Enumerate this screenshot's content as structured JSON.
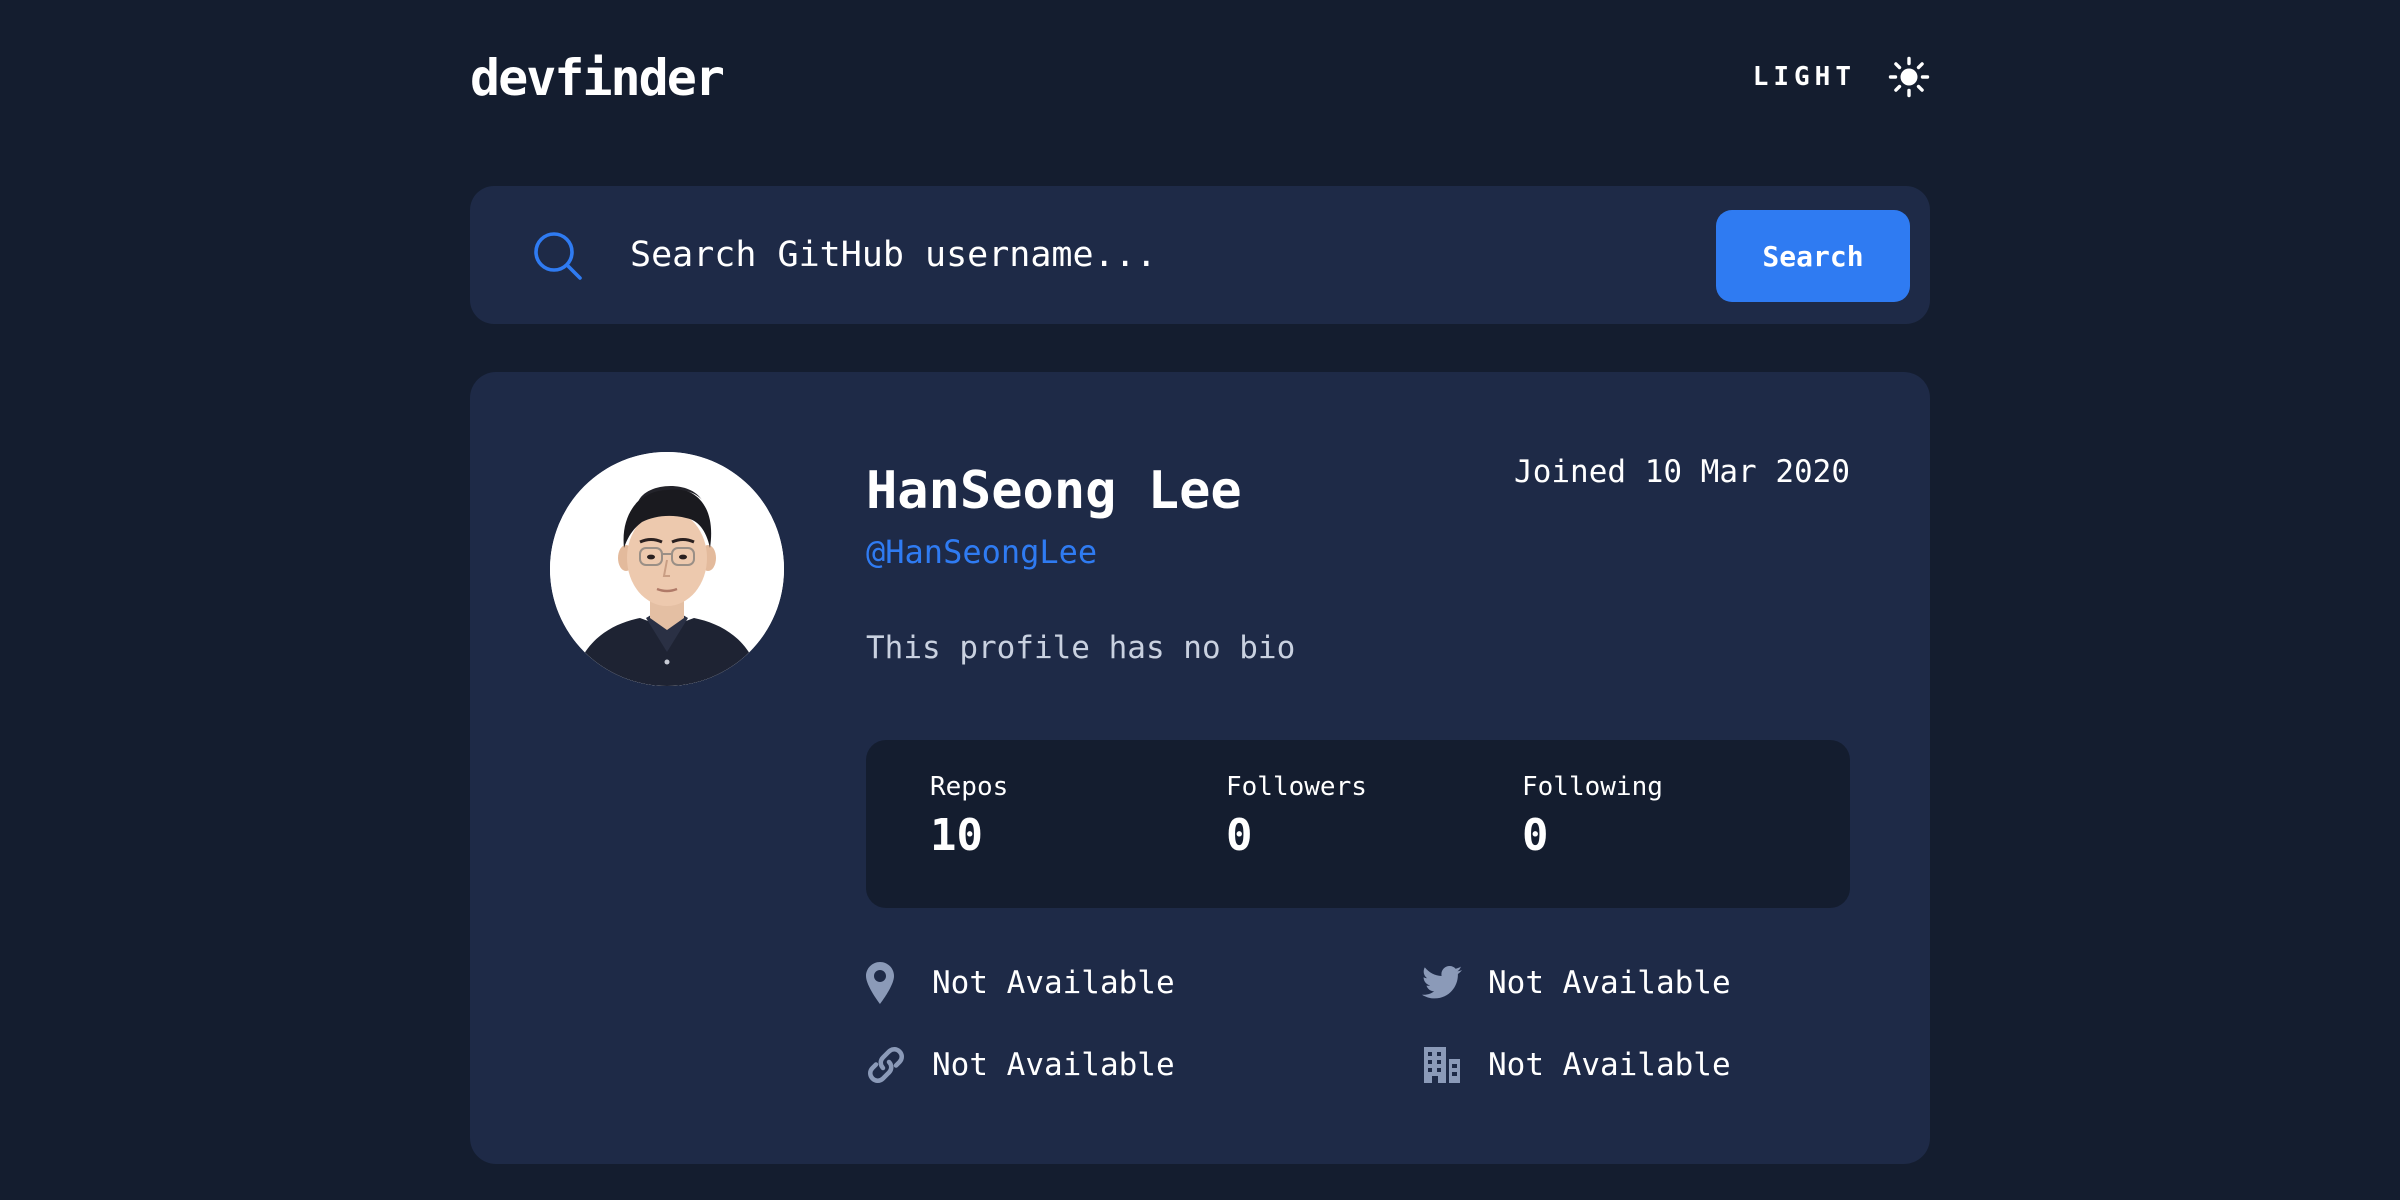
{
  "header": {
    "logo": "devfinder",
    "theme_toggle_label": "LIGHT",
    "theme_icon": "sun-icon"
  },
  "search": {
    "placeholder": "Search GitHub username...",
    "value": "",
    "button_label": "Search",
    "icon": "search-icon"
  },
  "profile": {
    "name": "HanSeong Lee",
    "login": "@HanSeongLee",
    "joined": "Joined 10 Mar 2020",
    "bio": "This profile has no bio",
    "avatar": "avatar-photo",
    "stats": [
      {
        "label": "Repos",
        "value": "10"
      },
      {
        "label": "Followers",
        "value": "0"
      },
      {
        "label": "Following",
        "value": "0"
      }
    ],
    "links": {
      "location": {
        "icon": "location-pin-icon",
        "text": "Not Available"
      },
      "twitter": {
        "icon": "twitter-icon",
        "text": "Not Available"
      },
      "website": {
        "icon": "link-icon",
        "text": "Not Available"
      },
      "company": {
        "icon": "company-building-icon",
        "text": "Not Available"
      }
    }
  },
  "colors": {
    "background": "#141D2F",
    "card": "#1E2A47",
    "accent": "#2F7BF2",
    "icon_muted": "#8B9AB8",
    "text": "#FFFFFF"
  }
}
